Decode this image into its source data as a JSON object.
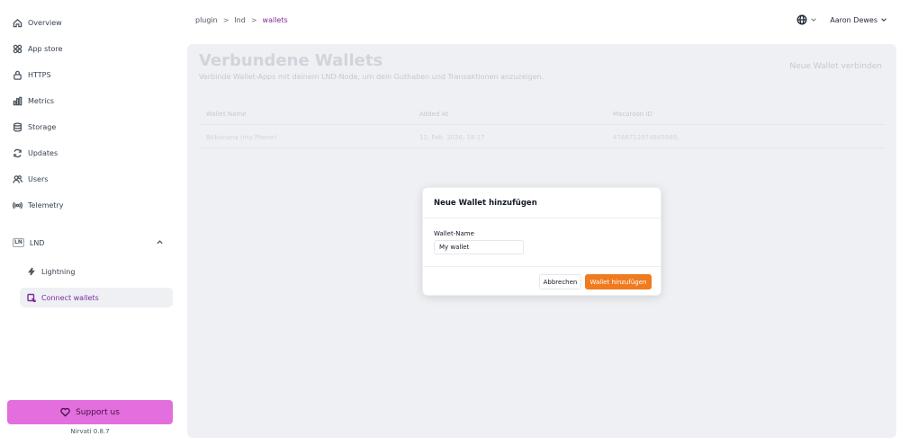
{
  "sidebar": {
    "items": [
      {
        "label": "Overview",
        "icon": "home-icon"
      },
      {
        "label": "App store",
        "icon": "grid-icon"
      },
      {
        "label": "HTTPS",
        "icon": "lock-icon"
      },
      {
        "label": "Metrics",
        "icon": "bar-chart-icon"
      },
      {
        "label": "Storage",
        "icon": "database-icon"
      },
      {
        "label": "Updates",
        "icon": "refresh-icon"
      },
      {
        "label": "Users",
        "icon": "users-icon"
      },
      {
        "label": "Telemetry",
        "icon": "broadcast-icon"
      }
    ],
    "group": {
      "badge": "LN",
      "label": "LND",
      "sub_items": [
        {
          "label": "Lightning",
          "icon": "bolt-icon"
        },
        {
          "label": "Connect wallets",
          "icon": "wallet-link-icon",
          "active": true
        }
      ]
    },
    "support_label": "Support us",
    "version": "Nirvati 0.8.7"
  },
  "breadcrumb": [
    "plugin",
    "lnd",
    "wallets"
  ],
  "header": {
    "user_name": "Aaron Dewes"
  },
  "main": {
    "title": "Verbundene Wallets",
    "subtitle": "Verbinde Wallet-Apps mit deinem LND-Node, um dein Guthaben und Transaktionen anzuzeigen.",
    "connect_label": "Neue Wallet verbinden",
    "table": {
      "columns": [
        "Wallet Name",
        "Added At",
        "Macaroon ID"
      ],
      "rows": [
        [
          "Bitbanana (my Phone)",
          "12. Feb. 2026, 18:17",
          "4766712974645989..."
        ]
      ]
    }
  },
  "modal": {
    "title": "Neue Wallet hinzufügen",
    "field_label": "Wallet-Name",
    "field_value": "My wallet",
    "cancel_label": "Abbrechen",
    "submit_label": "Wallet hinzufügen"
  },
  "colors": {
    "accent": "#7e2b9a",
    "primary_button": "#f07a1e",
    "support_button": "#e26fdd"
  }
}
